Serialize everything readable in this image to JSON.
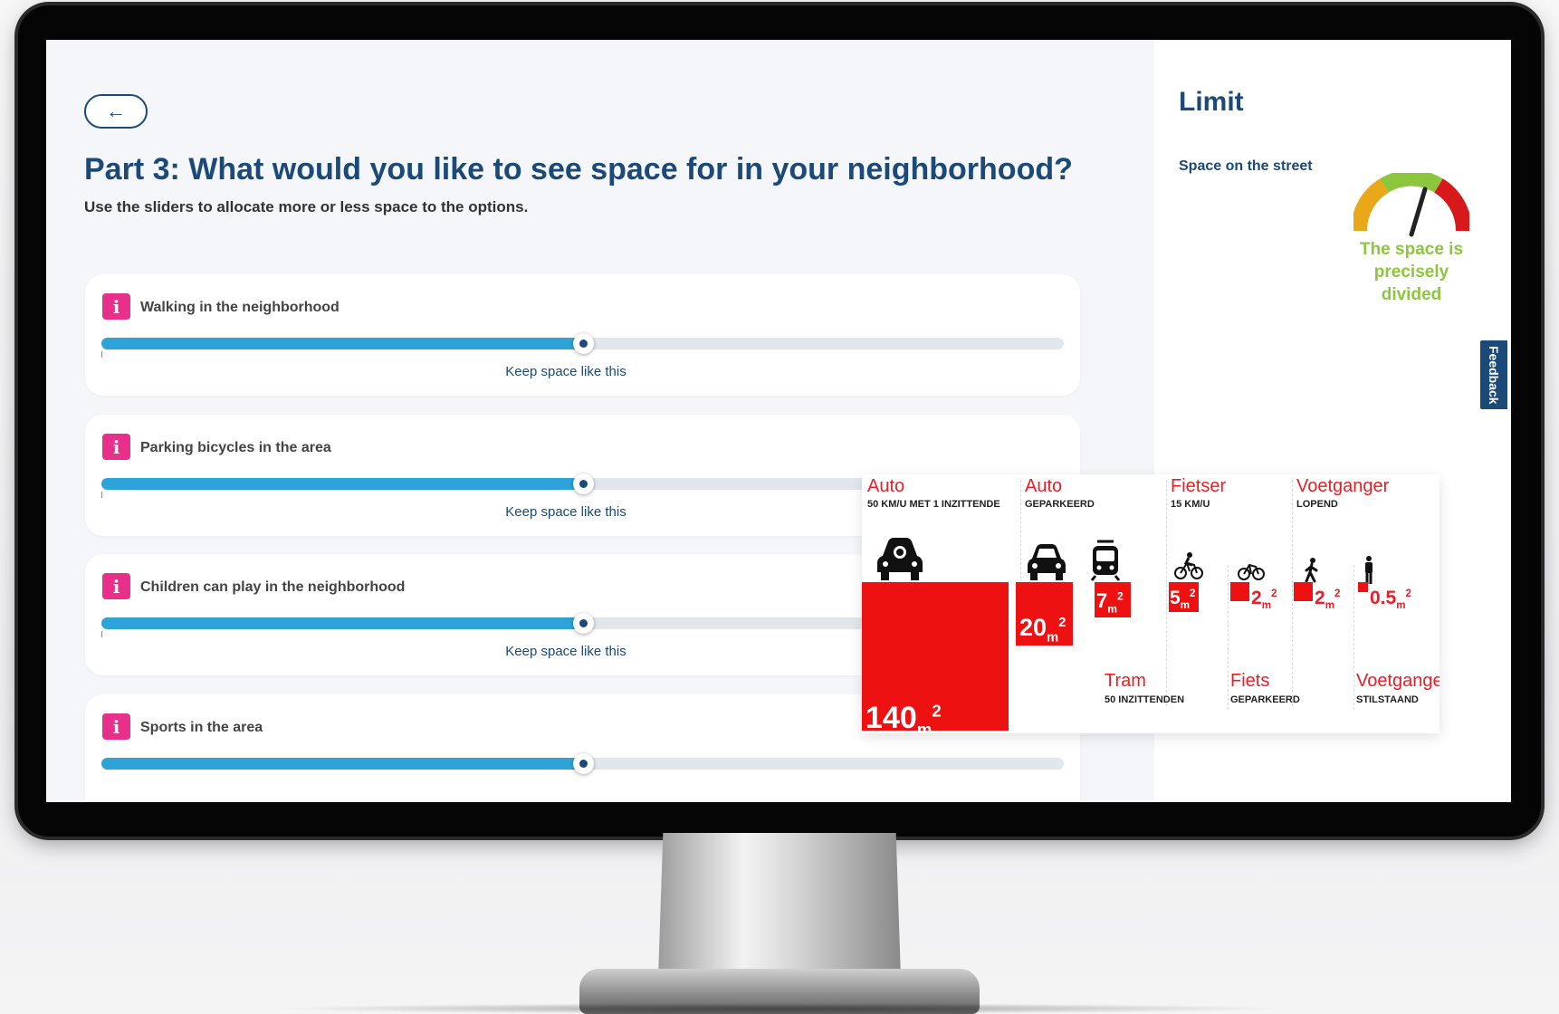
{
  "page": {
    "back_arrow": "←",
    "title": "Part 3: What would you like to see space for in your neighborhood?",
    "subtitle": "Use the sliders  to allocate more or less space to the options."
  },
  "sliders": [
    {
      "label": "Walking in the neighborhood",
      "value_fraction": 0.5,
      "caption": "Keep space like this",
      "info_icon": "i"
    },
    {
      "label": "Parking bicycles in the area",
      "value_fraction": 0.5,
      "caption": "Keep space like this",
      "info_icon": "i"
    },
    {
      "label": "Children can play in the neighborhood",
      "value_fraction": 0.5,
      "caption": "Keep space like this",
      "info_icon": "i"
    },
    {
      "label": "Sports in the area",
      "value_fraction": 0.5,
      "caption": "",
      "info_icon": "i"
    }
  ],
  "panel": {
    "title": "Limit",
    "space_label": "Space on the street",
    "gauge_status": "The space is precisely divided",
    "gauge_colors": [
      "#e9a81a",
      "#8cc63f",
      "#d7191c"
    ]
  },
  "feedback_label": "Feedback",
  "infographic": {
    "accent_color": "#ee1c24",
    "top_categories": [
      {
        "title": "Auto",
        "subtitle": "50 KM/U MET 1 INZITTENDE"
      },
      {
        "title": "Auto",
        "subtitle": "GEPARKEERD"
      },
      {
        "title": "Fietser",
        "subtitle": "15 KM/U"
      },
      {
        "title": "Voetganger",
        "subtitle": "LOPEND"
      }
    ],
    "areas": [
      {
        "value": "140",
        "unit": "m",
        "sup": "2",
        "icon": "car-moving-icon"
      },
      {
        "value": "20",
        "unit": "m",
        "sup": "2",
        "icon": "car-parked-icon"
      },
      {
        "value": "7",
        "unit": "m",
        "sup": "2",
        "icon": "tram-icon"
      },
      {
        "value": "5",
        "unit": "m",
        "sup": "2",
        "icon": "cyclist-icon"
      },
      {
        "value": "2",
        "unit": "m",
        "sup": "2",
        "icon": "bicycle-parked-icon"
      },
      {
        "value": "2",
        "unit": "m",
        "sup": "2",
        "icon": "walking-person-icon"
      },
      {
        "value": "0.5",
        "unit": "m",
        "sup": "2",
        "icon": "standing-person-icon"
      }
    ],
    "bottom_categories": [
      {
        "title": "Tram",
        "subtitle": "50 INZITTENDEN"
      },
      {
        "title": "Fiets",
        "subtitle": "GEPARKEERD"
      },
      {
        "title": "Voetganger",
        "subtitle": "STILSTAAND"
      }
    ]
  }
}
